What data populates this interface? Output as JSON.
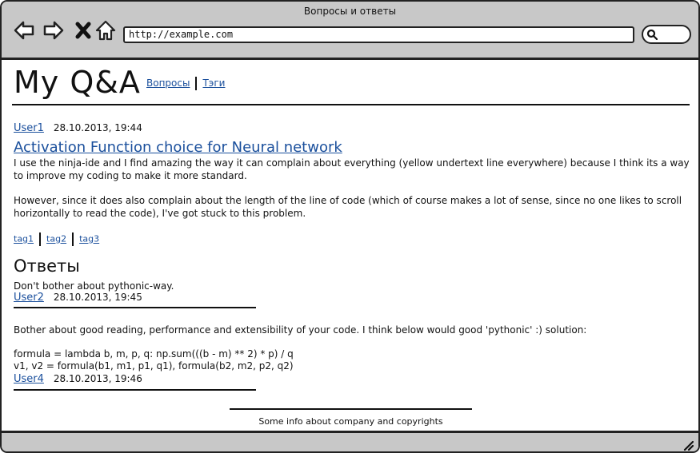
{
  "window": {
    "title": "Вопросы и ответы"
  },
  "browser": {
    "url": "http://example.com",
    "icons": {
      "back": "arrow-left-icon",
      "forward": "arrow-right-icon",
      "stop": "close-icon",
      "home": "home-icon",
      "search": "search-icon"
    }
  },
  "header": {
    "logo": "My Q&A",
    "nav": [
      {
        "label": "Вопросы"
      },
      {
        "label": "Тэги"
      }
    ]
  },
  "question": {
    "author": "User1",
    "date": "28.10.2013, 19:44",
    "title": "Activation Function choice for Neural network",
    "body": [
      "I use the ninja-ide and I find amazing the way it can complain about everything (yellow undertext line everywhere) because I think its a way to improve my coding to make it more standard.",
      "However, since it does also complain about the length of the line of code (which of course makes a lot of sense, since no one likes to scroll horizontally to read the code), I've got stuck to this problem."
    ],
    "tags": [
      "tag1",
      "tag2",
      "tag3"
    ]
  },
  "answers": {
    "heading": "Ответы",
    "items": [
      {
        "text": "Don't bother about pythonic-way.",
        "author": "User2",
        "date": "28.10.2013, 19:45"
      },
      {
        "text": "Bother about good reading, performance and extensibility of your code. I think below would good 'pythonic' :) solution:",
        "code": "formula = lambda b, m, p, q: np.sum(((b - m) ** 2) * p) / q\nv1, v2 = formula(b1, m1, p1, q1), formula(b2, m2, p2, q2)",
        "author": "User4",
        "date": "28.10.2013, 19:46"
      }
    ]
  },
  "footer": {
    "text": "Some info about company and copyrights"
  },
  "colors": {
    "link": "#1a4f9c",
    "chrome": "#c8c8c8",
    "border": "#222222"
  }
}
